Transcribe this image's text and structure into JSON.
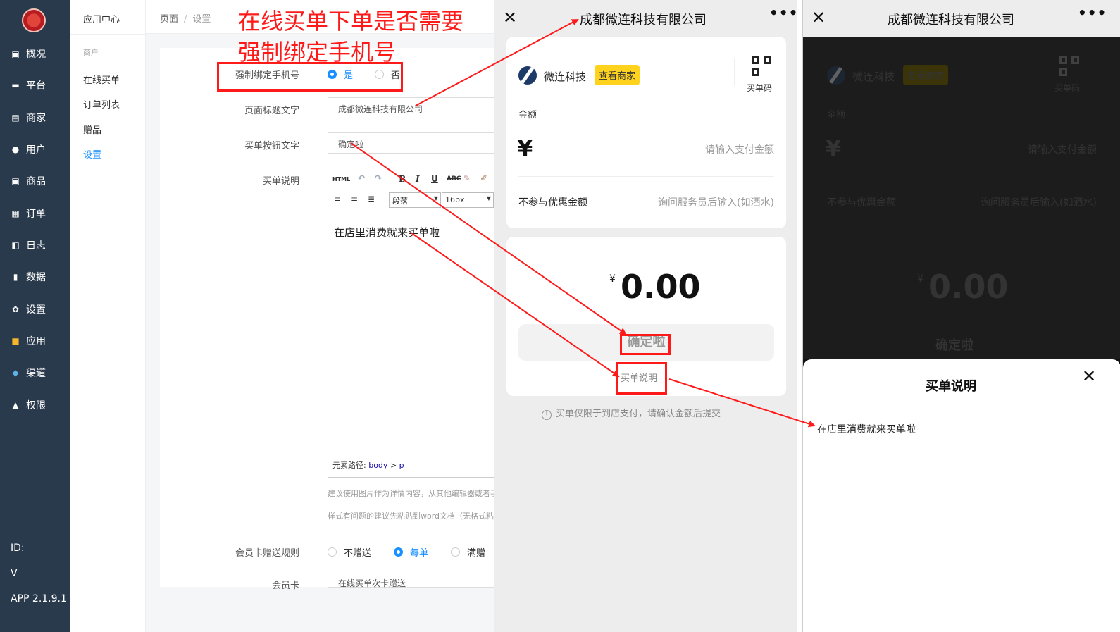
{
  "sidebar": {
    "items": [
      {
        "label": "概况",
        "icon": "overview-icon"
      },
      {
        "label": "平台",
        "icon": "monitor-icon"
      },
      {
        "label": "商家",
        "icon": "shop-icon"
      },
      {
        "label": "用户",
        "icon": "user-icon"
      },
      {
        "label": "商品",
        "icon": "goods-icon"
      },
      {
        "label": "订单",
        "icon": "order-icon"
      },
      {
        "label": "日志",
        "icon": "log-icon"
      },
      {
        "label": "数据",
        "icon": "chart-icon"
      },
      {
        "label": "设置",
        "icon": "gear-icon"
      },
      {
        "label": "应用",
        "icon": "apps-icon"
      },
      {
        "label": "渠道",
        "icon": "channel-icon"
      },
      {
        "label": "权限",
        "icon": "lock-icon"
      }
    ],
    "id_label": "ID:",
    "v_label": "V",
    "app_version": "APP 2.1.9.1"
  },
  "submenu": {
    "title": "应用中心",
    "group": "商户",
    "items": [
      "在线买单",
      "订单列表",
      "赠品",
      "设置"
    ]
  },
  "breadcrumb": {
    "first": "页面",
    "sep": "/",
    "current": "设置"
  },
  "form": {
    "bind_phone_label": "强制绑定手机号",
    "yes": "是",
    "no": "否",
    "page_title_label": "页面标题文字",
    "page_title_value": "成都微连科技有限公司",
    "button_text_label": "买单按钮文字",
    "button_text_value": "确定啦",
    "desc_label": "买单说明",
    "editor": {
      "paragraph": "段落",
      "font_size": "16px",
      "content": "在店里消费就来买单啦",
      "path_label": "元素路径:",
      "path_body": "body",
      "path_gt": ">",
      "path_p": "p",
      "html": "HTML"
    },
    "hint1": "建议使用图片作为详情内容，从其他编辑器或者手",
    "hint2": "样式有问题的建议先粘贴到word文档（无格式粘贴",
    "gift_rule_label": "会员卡赠送规则",
    "gift_opts": [
      "不赠送",
      "每单",
      "满赠"
    ],
    "next_label": "会员卡",
    "next_value": "在线买单次卡赠送"
  },
  "annotation": {
    "line1": "在线买单下单是否需要",
    "line2": "强制绑定手机号"
  },
  "phone": {
    "title": "成都微连科技有限公司",
    "close": "✕",
    "more": "•••",
    "merchant": "微连科技",
    "view_merchant": "查看商家",
    "qr_label": "买单码",
    "amount_label": "金额",
    "currency": "¥",
    "amount_placeholder": "请输入支付金额",
    "exclude_label": "不参与优惠金额",
    "exclude_placeholder": "询问服务员后输入(如酒水)",
    "total": "0.00",
    "confirm": "确定啦",
    "desc_link": "买单说明",
    "notice": "买单仅限于到店支付，请确认金额后提交"
  },
  "sheet": {
    "title": "买单说明",
    "content": "在店里消费就来买单啦",
    "close": "✕"
  },
  "colors": {
    "accent": "#1890ff",
    "annotation": "#ff1a1a",
    "sidebar": "#2a3a4d",
    "badge": "#ffd21e"
  }
}
